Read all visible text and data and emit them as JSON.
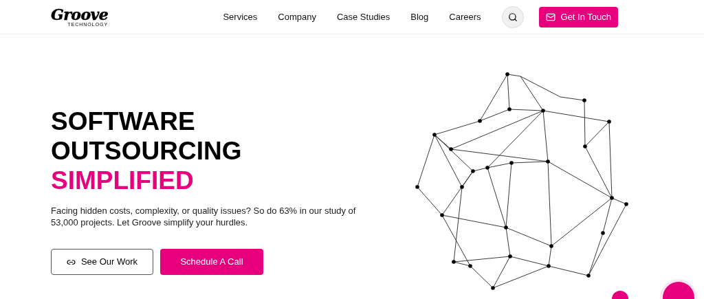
{
  "logo": {
    "name": "Groove",
    "tagline": "TECHNOLOGY"
  },
  "nav": [
    {
      "label": "Services"
    },
    {
      "label": "Company"
    },
    {
      "label": "Case Studies"
    },
    {
      "label": "Blog"
    },
    {
      "label": "Careers"
    }
  ],
  "contact_button": "Get In Touch",
  "hero": {
    "title_lines": [
      {
        "text": "SOFTWARE",
        "kind": "plain"
      },
      {
        "text": "OUTSOURCING",
        "kind": "plain"
      },
      {
        "text": "SIMPLIFIED",
        "kind": "accent"
      }
    ],
    "description": "Facing hidden costs, complexity, or quality issues? So do 63% in our study of 53,000 projects. Let Groove simplify your hurdles.",
    "buttons": [
      {
        "label": "See Our Work",
        "kind": "outline"
      },
      {
        "label": "Schedule A Call",
        "kind": "filled"
      }
    ]
  }
}
